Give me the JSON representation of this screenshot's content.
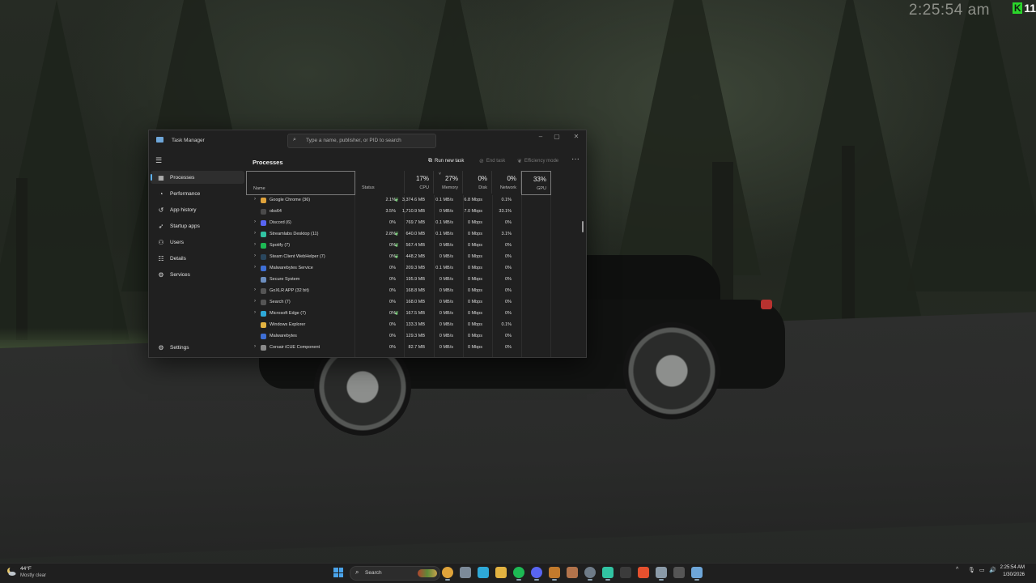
{
  "overlay": {
    "clock": "2:25:54 am",
    "badge_letter": "K",
    "badge_number": "11"
  },
  "window": {
    "title": "Task Manager",
    "search_placeholder": "Type a name, publisher, or PID to search",
    "controls": {
      "minimize": "–",
      "maximize": "▢",
      "close": "✕"
    }
  },
  "sidebar": {
    "menu_icon": "hamburger-icon",
    "items": [
      {
        "label": "Processes",
        "icon": "processes-icon",
        "active": true
      },
      {
        "label": "Performance",
        "icon": "performance-icon"
      },
      {
        "label": "App history",
        "icon": "app-history-icon"
      },
      {
        "label": "Startup apps",
        "icon": "startup-apps-icon"
      },
      {
        "label": "Users",
        "icon": "users-icon"
      },
      {
        "label": "Details",
        "icon": "details-icon"
      },
      {
        "label": "Services",
        "icon": "services-icon"
      }
    ],
    "settings_label": "Settings"
  },
  "toolbar": {
    "title": "Processes",
    "run_new_task": "Run new task",
    "end_task": "End task",
    "efficiency_mode": "Efficiency mode",
    "more": "···"
  },
  "columns": {
    "name": "Name",
    "status": "Status",
    "cpu": {
      "pct": "17%",
      "label": "CPU"
    },
    "memory": {
      "pct": "27%",
      "label": "Memory"
    },
    "disk": {
      "pct": "0%",
      "label": "Disk"
    },
    "network": {
      "pct": "0%",
      "label": "Network"
    },
    "gpu": {
      "pct": "33%",
      "label": "GPU"
    }
  },
  "processes": [
    {
      "name": "Google Chrome (36)",
      "expand": true,
      "leaf": true,
      "color": "#e0a33b",
      "cpu": "2.1%",
      "mem": "3,374.6 MB",
      "disk": "0.1 MB/s",
      "net": "6.8 Mbps",
      "gpu": "0.1%"
    },
    {
      "name": "obs64",
      "expand": false,
      "leaf": false,
      "color": "#4a4a4a",
      "cpu": "3.5%",
      "mem": "1,710.9 MB",
      "disk": "0 MB/s",
      "net": "7.0 Mbps",
      "gpu": "33.1%"
    },
    {
      "name": "Discord (6)",
      "expand": true,
      "leaf": false,
      "color": "#5865f2",
      "cpu": "0%",
      "mem": "769.7 MB",
      "disk": "0.1 MB/s",
      "net": "0 Mbps",
      "gpu": "0%"
    },
    {
      "name": "Streamlabs Desktop (11)",
      "expand": true,
      "leaf": true,
      "color": "#31c3a2",
      "cpu": "2.8%",
      "mem": "640.0 MB",
      "disk": "0.1 MB/s",
      "net": "0 Mbps",
      "gpu": "3.1%"
    },
    {
      "name": "Spotify (7)",
      "expand": true,
      "leaf": true,
      "color": "#1db954",
      "cpu": "0%",
      "mem": "567.4 MB",
      "disk": "0 MB/s",
      "net": "0 Mbps",
      "gpu": "0%"
    },
    {
      "name": "Steam Client WebHelper (7)",
      "expand": true,
      "leaf": true,
      "color": "#2a475e",
      "cpu": "0%",
      "mem": "448.2 MB",
      "disk": "0 MB/s",
      "net": "0 Mbps",
      "gpu": "0%"
    },
    {
      "name": "Malwarebytes Service",
      "expand": true,
      "leaf": false,
      "color": "#3e6fd6",
      "cpu": "0%",
      "mem": "209.3 MB",
      "disk": "0.1 MB/s",
      "net": "0 Mbps",
      "gpu": "0%"
    },
    {
      "name": "Secure System",
      "expand": false,
      "leaf": false,
      "color": "#6c8ebf",
      "cpu": "0%",
      "mem": "195.9 MB",
      "disk": "0 MB/s",
      "net": "0 Mbps",
      "gpu": "0%"
    },
    {
      "name": "GoXLR APP (32 bit)",
      "expand": true,
      "leaf": false,
      "color": "#555555",
      "cpu": "0%",
      "mem": "168.8 MB",
      "disk": "0 MB/s",
      "net": "0 Mbps",
      "gpu": "0%"
    },
    {
      "name": "Search (7)",
      "expand": true,
      "leaf": false,
      "color": "#555555",
      "cpu": "0%",
      "mem": "168.0 MB",
      "disk": "0 MB/s",
      "net": "0 Mbps",
      "gpu": "0%"
    },
    {
      "name": "Microsoft Edge (7)",
      "expand": true,
      "leaf": true,
      "color": "#2ea9d8",
      "cpu": "0%",
      "mem": "167.5 MB",
      "disk": "0 MB/s",
      "net": "0 Mbps",
      "gpu": "0%"
    },
    {
      "name": "Windows Explorer",
      "expand": false,
      "leaf": false,
      "color": "#e3b341",
      "cpu": "0%",
      "mem": "133.3 MB",
      "disk": "0 MB/s",
      "net": "0 Mbps",
      "gpu": "0.1%"
    },
    {
      "name": "Malwarebytes",
      "expand": false,
      "leaf": false,
      "color": "#3e6fd6",
      "cpu": "0%",
      "mem": "129.3 MB",
      "disk": "0 MB/s",
      "net": "0 Mbps",
      "gpu": "0%"
    },
    {
      "name": "Corsair iCUE Component",
      "expand": true,
      "leaf": false,
      "color": "#8a8a8a",
      "cpu": "0%",
      "mem": "82.7 MB",
      "disk": "0 MB/s",
      "net": "0 Mbps",
      "gpu": "0%"
    }
  ],
  "taskbar": {
    "weather": {
      "temp": "44°F",
      "desc": "Mostly clear",
      "icon": "moon-cloud-icon"
    },
    "search_label": "Search",
    "apps": [
      {
        "name": "chrome",
        "color": "#dfa33a",
        "running": true
      },
      {
        "name": "file-explorer",
        "color": "#7c8a99",
        "running": false
      },
      {
        "name": "edge",
        "color": "#2ea9d8",
        "running": false
      },
      {
        "name": "folder",
        "color": "#e3b341",
        "running": false
      },
      {
        "name": "spotify",
        "color": "#1db954",
        "running": true
      },
      {
        "name": "discord",
        "color": "#5865f2",
        "running": true
      },
      {
        "name": "obs",
        "color": "#c27a2c",
        "running": true
      },
      {
        "name": "adobe-illustrator",
        "color": "#b2734b",
        "running": false
      },
      {
        "name": "steam",
        "color": "#6e7b88",
        "running": true
      },
      {
        "name": "streamlabs",
        "color": "#31c3a2",
        "running": true
      },
      {
        "name": "terminal",
        "color": "#3b3b3b",
        "running": false
      },
      {
        "name": "brave",
        "color": "#e5502e",
        "running": false
      },
      {
        "name": "settings",
        "color": "#8a9aa8",
        "running": true
      },
      {
        "name": "xbox",
        "color": "#555555",
        "running": false
      },
      {
        "name": "task-manager",
        "color": "#6ea6d9",
        "running": true
      }
    ],
    "tray": {
      "chevron": "^",
      "mic": "🎙",
      "network": "▭",
      "volume": "🔊"
    },
    "time": "2:25:54 AM",
    "date": "1/30/2026"
  }
}
